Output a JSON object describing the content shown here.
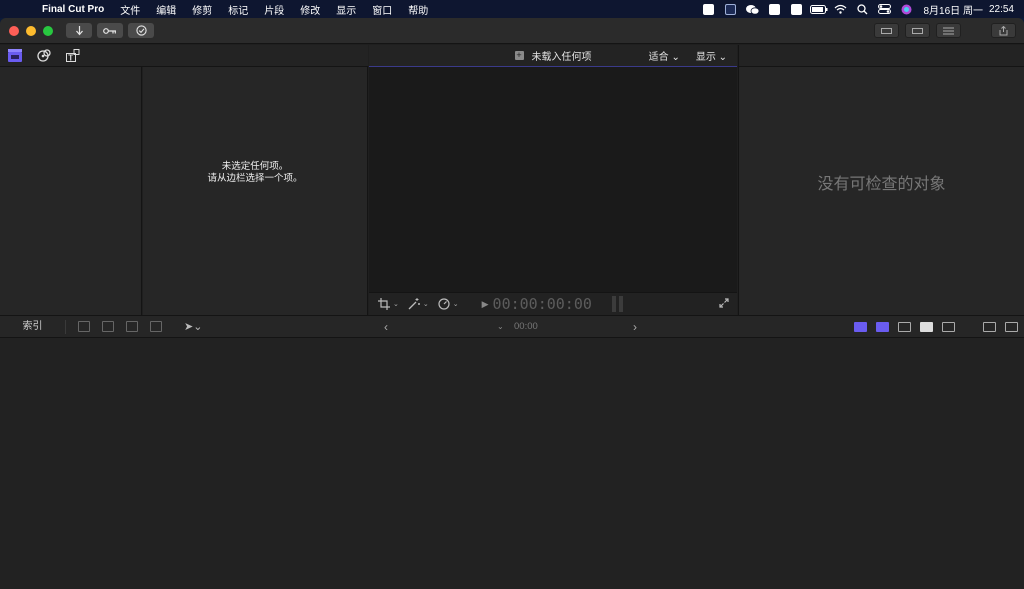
{
  "menubar": {
    "app_name": "Final Cut Pro",
    "items": [
      "文件",
      "编辑",
      "修剪",
      "标记",
      "片段",
      "修改",
      "显示",
      "窗口",
      "帮助"
    ],
    "date": "8月16日 周一",
    "time": "22:54"
  },
  "titlebar": {
    "import_icon": "download-arrow-icon",
    "keyword_icon": "key-icon",
    "background_tasks_icon": "checkmark-circle-icon"
  },
  "browser": {
    "empty_line1": "未选定任何项。",
    "empty_line2": "请从边栏选择一个项。"
  },
  "viewer": {
    "title": "未载入任何项",
    "fit_label": "适合",
    "view_label": "显示",
    "timecode": "00:00:00:00"
  },
  "inspector": {
    "empty_message": "没有可检查的对象"
  },
  "timeline": {
    "index_label": "索引",
    "timecode": "00:00"
  },
  "colors": {
    "accent": "#6a5cf0",
    "window_bg": "#1f1f1f",
    "panel_bg": "#262626"
  }
}
